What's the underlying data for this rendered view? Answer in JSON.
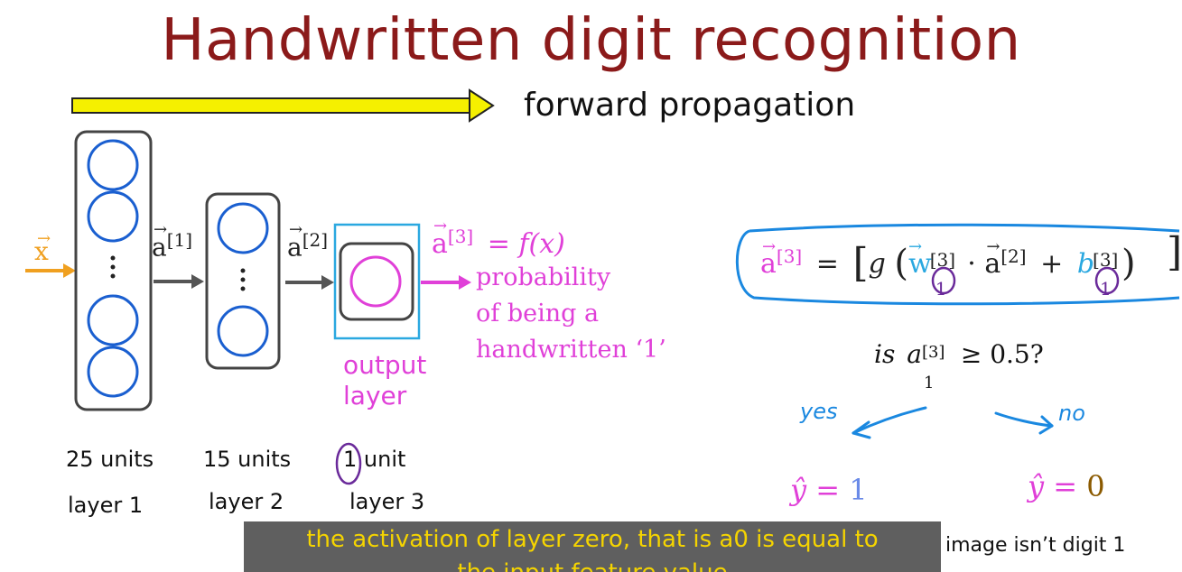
{
  "title": "Handwritten digit recognition",
  "forward_label": "forward propagation",
  "network": {
    "input_label": "x",
    "a1_label": "a",
    "a1_sup": "[1]",
    "a2_label": "a",
    "a2_sup": "[2]",
    "output_eq_label": "a",
    "output_eq_sup": "[3]",
    "output_eq_rhs": "= f(x)",
    "prob_line1": "probability",
    "prob_line2": "of being a",
    "prob_line3": "handwritten ‘1’",
    "output_layer_line1": "output",
    "output_layer_line2": "layer"
  },
  "layers": [
    {
      "units": "25 units",
      "name": "layer 1"
    },
    {
      "units": "15 units",
      "name": "layer 2"
    },
    {
      "units_num": "1",
      "units_word": "unit",
      "name": "layer 3"
    }
  ],
  "formula": {
    "lhs": "a",
    "lhs_sup": "[3]",
    "eq": "=",
    "g": "g",
    "w": "w",
    "w_sup": "[3]",
    "w_sub": "1",
    "dot": "·",
    "a2": "a",
    "a2_sup": "[2]",
    "plus": "+",
    "b": "b",
    "b_sup": "[3]",
    "b_sub": "1"
  },
  "question": {
    "prefix": "is",
    "a": "a",
    "sup": "[3]",
    "sub": "1",
    "rest": "≥ 0.5?"
  },
  "decision": {
    "yes": "yes",
    "no": "no",
    "yhat1_lhs": "ŷ =",
    "yhat1_val": "1",
    "yhat0_lhs": "ŷ =",
    "yhat0_val": "0",
    "right_caption": "image isn’t digit 1"
  },
  "subtitle": {
    "line1": "the activation of layer zero, that is a0 is equal to",
    "line2": "the input feature value"
  },
  "colors": {
    "title": "#8b1a1a",
    "neuron": "#1a5fd0",
    "pink": "#e040d8",
    "orange": "#f0a020",
    "cyan_box": "#2aa8e0",
    "highlight": "#1a88e0",
    "yellow_arrow": "#f5f000",
    "brown": "#8b5a00",
    "purple": "#6a2a9a"
  }
}
